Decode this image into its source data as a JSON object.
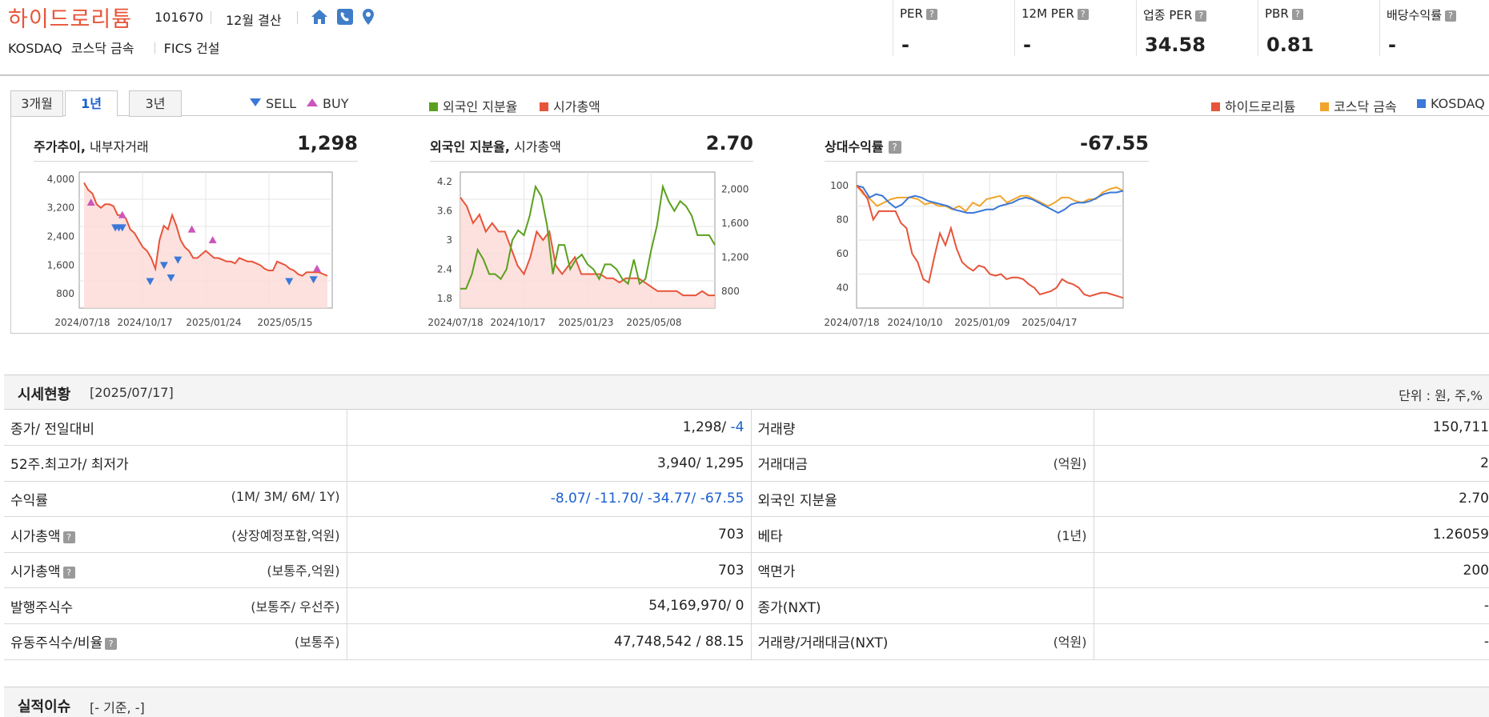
{
  "header": {
    "company_name": "하이드로리튬",
    "code": "101670",
    "settlement": "12월 결산",
    "market": "KOSDAQ",
    "sector": "코스닥 금속",
    "fics": "FICS 건설",
    "icons": [
      "home-icon",
      "phone-icon",
      "location-pin-icon"
    ],
    "metrics": [
      {
        "label": "PER",
        "value": "-"
      },
      {
        "label": "12M PER",
        "value": "-"
      },
      {
        "label": "업종 PER",
        "value": "34.58"
      },
      {
        "label": "PBR",
        "value": "0.81"
      },
      {
        "label": "배당수익률",
        "value": "-"
      }
    ]
  },
  "tabs": [
    {
      "label": "3개월",
      "active": false
    },
    {
      "label": "1년",
      "active": true
    },
    {
      "label": "3년",
      "active": false
    }
  ],
  "legends": {
    "sell": "SELL",
    "buy": "BUY",
    "foreign_ratio": "외국인 지분율",
    "market_cap": "시가총액",
    "company": "하이드로리튬",
    "sector_index": "코스닥 금속",
    "kosdaq": "KOSDAQ"
  },
  "colors": {
    "red": "#e8543a",
    "green": "#5aa01e",
    "orange": "#f2a52c",
    "blue": "#3b78d8",
    "sell": "#3b78d8",
    "buy": "#cc55bb"
  },
  "panels": {
    "price": {
      "title_bold": "주가추이,",
      "title_rest": " 내부자거래",
      "value": "1,298"
    },
    "foreign": {
      "title_bold": "외국인 지분율,",
      "title_rest": " 시가총액",
      "value": "2.70"
    },
    "relative": {
      "title": "상대수익률",
      "value": "-67.55"
    }
  },
  "chart_data": [
    {
      "type": "line",
      "title": "주가추이, 내부자거래",
      "x_ticks": [
        "2024/07/18",
        "2024/10/17",
        "2025/01/24",
        "2025/05/15"
      ],
      "y_ticks": [
        "4,000",
        "3,200",
        "2,400",
        "1,600",
        "800"
      ],
      "ylim": [
        400,
        4200
      ],
      "series": [
        {
          "values": [
            3900,
            3700,
            3600,
            3300,
            3200,
            3300,
            3300,
            3250,
            3000,
            3000,
            2900,
            2600,
            2500,
            2300,
            2100,
            2000,
            1800,
            1500,
            2300,
            2700,
            2600,
            3000,
            2700,
            2300,
            2100,
            2000,
            1800,
            1800,
            1900,
            2000,
            1900,
            1800,
            1800,
            1750,
            1700,
            1700,
            1650,
            1800,
            1750,
            1700,
            1700,
            1650,
            1600,
            1500,
            1450,
            1450,
            1700,
            1650,
            1600,
            1500,
            1450,
            1350,
            1300,
            1400,
            1400,
            1400,
            1400,
            1350,
            1300
          ]
        }
      ],
      "sell_markers": [
        [
          9,
          2650
        ],
        [
          10,
          2650
        ],
        [
          11,
          2650
        ],
        [
          19,
          1150
        ],
        [
          23,
          1600
        ],
        [
          25,
          1250
        ],
        [
          27,
          1750
        ],
        [
          59,
          1150
        ],
        [
          66,
          1200
        ]
      ],
      "buy_markers": [
        [
          2,
          3350
        ],
        [
          11,
          3000
        ],
        [
          31,
          2600
        ],
        [
          37,
          2300
        ],
        [
          67,
          1500
        ]
      ]
    },
    {
      "type": "line",
      "title": "외국인 지분율, 시가총액",
      "x_ticks": [
        "2024/07/18",
        "2024/10/17",
        "2025/01/23",
        "2025/05/08"
      ],
      "y_ticks_left": [
        "4.2",
        "3.6",
        "3",
        "2.4",
        "1.8"
      ],
      "y_ticks_right": [
        "2,000",
        "1,600",
        "1,200",
        "800"
      ],
      "series": [
        {
          "name": "외국인 지분율",
          "values": [
            2.0,
            2.0,
            2.3,
            2.8,
            2.6,
            2.3,
            2.3,
            2.2,
            2.4,
            3.0,
            3.2,
            3.1,
            3.5,
            4.1,
            3.9,
            3.3,
            2.3,
            2.9,
            2.9,
            2.4,
            2.6,
            2.7,
            2.5,
            2.4,
            2.2,
            2.5,
            2.5,
            2.4,
            2.2,
            2.1,
            2.6,
            2.1,
            2.2,
            2.8,
            3.3,
            4.1,
            3.8,
            3.6,
            3.8,
            3.7,
            3.5,
            3.1,
            3.1,
            3.1,
            2.9
          ]
        },
        {
          "name": "시가총액",
          "values": [
            1900,
            1800,
            1600,
            1700,
            1500,
            1600,
            1500,
            1500,
            1300,
            1100,
            1000,
            1200,
            1500,
            1400,
            1500,
            1100,
            1000,
            1100,
            1200,
            1000,
            1000,
            1000,
            1000,
            950,
            950,
            900,
            950,
            950,
            950,
            900,
            850,
            800,
            800,
            800,
            800,
            750,
            750,
            750,
            800,
            750,
            750
          ]
        }
      ]
    },
    {
      "type": "line",
      "title": "상대수익률",
      "x_ticks": [
        "2024/07/18",
        "2024/10/10",
        "2025/01/09",
        "2025/04/17"
      ],
      "y_ticks": [
        "100",
        "80",
        "60",
        "40"
      ],
      "ylim": [
        28,
        108
      ],
      "series": [
        {
          "name": "하이드로리튬",
          "values": [
            100,
            97,
            92,
            80,
            85,
            85,
            85,
            85,
            78,
            75,
            60,
            55,
            45,
            43,
            58,
            72,
            65,
            75,
            63,
            55,
            52,
            50,
            53,
            52,
            48,
            47,
            48,
            45,
            46,
            46,
            45,
            42,
            40,
            36,
            37,
            38,
            40,
            45,
            43,
            42,
            40,
            36,
            35,
            36,
            37,
            37,
            36,
            35,
            34
          ]
        },
        {
          "name": "코스닥 금속",
          "values": [
            100,
            95,
            92,
            88,
            90,
            92,
            93,
            93,
            93,
            92,
            89,
            90,
            88,
            88,
            86,
            88,
            85,
            90,
            88,
            92,
            93,
            94,
            90,
            92,
            94,
            94,
            92,
            90,
            88,
            90,
            93,
            93,
            91,
            90,
            92,
            92,
            96,
            98,
            99,
            97
          ]
        },
        {
          "name": "KOSDAQ",
          "values": [
            100,
            99,
            93,
            95,
            94,
            90,
            87,
            89,
            93,
            94,
            93,
            91,
            90,
            89,
            88,
            86,
            85,
            84,
            84,
            85,
            86,
            86,
            88,
            89,
            90,
            92,
            93,
            92,
            90,
            88,
            86,
            84,
            86,
            89,
            90,
            90,
            91,
            93,
            95,
            96,
            96,
            97
          ]
        }
      ]
    }
  ],
  "quote_section": {
    "title": "시세현황",
    "date": "[2025/07/17]",
    "unit": "단위 : 원, 주,%",
    "rows": [
      {
        "label": "종가/ 전일대비",
        "sub": "",
        "value": "1,298/ ",
        "value_blue": "-4",
        "label2": "거래량",
        "sub2": "",
        "value2": "150,711"
      },
      {
        "label": "52주.최고가/ 최저가",
        "sub": "",
        "value": "3,940/ 1,295",
        "value_blue": "",
        "label2": "거래대금",
        "sub2": "(억원)",
        "value2": "2"
      },
      {
        "label": "수익률",
        "sub": "(1M/ 3M/ 6M/ 1Y)",
        "value": "",
        "value_blue": "-8.07/ -11.70/ -34.77/ -67.55",
        "label2": "외국인 지분율",
        "sub2": "",
        "value2": "2.70"
      },
      {
        "label": "시가총액",
        "sub": "(상장예정포함,억원)",
        "value": "703",
        "value_blue": "",
        "label2": "베타",
        "sub2": "(1년)",
        "value2": "1.26059"
      },
      {
        "label": "시가총액",
        "sub": "(보통주,억원)",
        "value": "703",
        "value_blue": "",
        "label2": "액면가",
        "sub2": "",
        "value2": "200"
      },
      {
        "label": "발행주식수",
        "sub": "(보통주/ 우선주)",
        "value": "54,169,970/ 0",
        "value_blue": "",
        "label2": "종가(NXT)",
        "sub2": "",
        "value2": "-"
      },
      {
        "label": "유동주식수/비율",
        "sub": "(보통주)",
        "value": "47,748,542 / 88.15",
        "value_blue": "",
        "label2": "거래량/거래대금(NXT)",
        "sub2": "(억원)",
        "value2": "-"
      }
    ]
  },
  "perf_section": {
    "title": "실적이슈",
    "basis": "[- 기준, -]"
  }
}
